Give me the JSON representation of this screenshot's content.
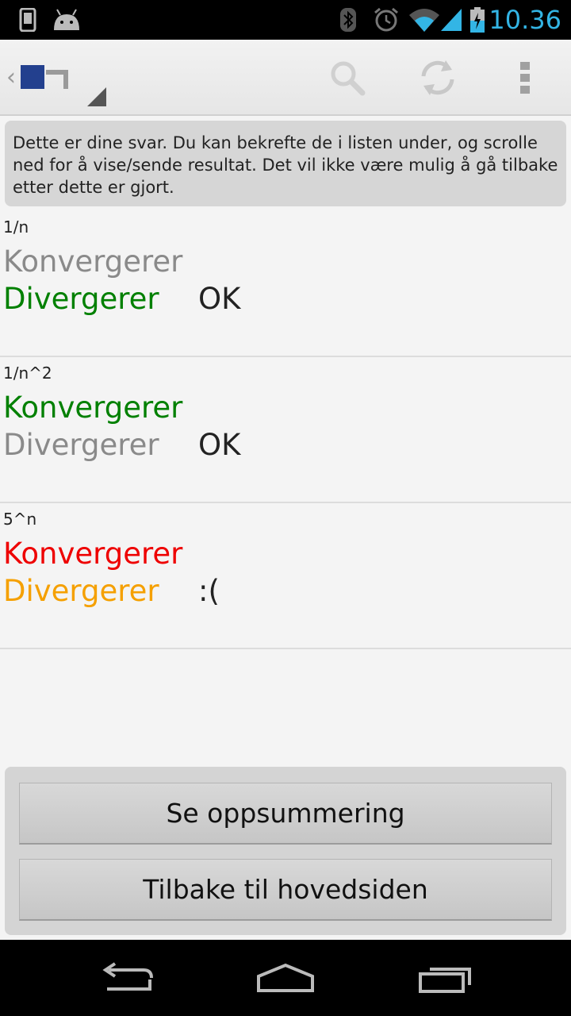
{
  "status_bar": {
    "time": "10.36",
    "icons": [
      "phone-icon",
      "android-icon",
      "bluetooth-icon",
      "alarm-icon",
      "wifi-icon",
      "signal-icon",
      "battery-charging-icon"
    ],
    "accent_color": "#33b5e5"
  },
  "action_bar": {
    "up_indicator": "‹",
    "logo_icon": "app-logo-icon",
    "actions": [
      "search-icon",
      "refresh-icon",
      "overflow-menu-icon"
    ]
  },
  "info": {
    "text": "Dette er dine svar. Du kan bekrefte de i listen under, og scrolle ned for å vise/sende resultat. Det vil ikke være mulig å gå tilbake etter dette er gjort."
  },
  "answers": [
    {
      "question": "1/n",
      "option1": {
        "label": "Konvergerer",
        "color": "#8a8a8a"
      },
      "option2": {
        "label": "Divergerer",
        "color": "#008000"
      },
      "verdict": "OK"
    },
    {
      "question": "1/n^2",
      "option1": {
        "label": "Konvergerer",
        "color": "#008000"
      },
      "option2": {
        "label": "Divergerer",
        "color": "#8a8a8a"
      },
      "verdict": "OK"
    },
    {
      "question": "5^n",
      "option1": {
        "label": "Konvergerer",
        "color": "#ee0000"
      },
      "option2": {
        "label": "Divergerer",
        "color": "#f5a000"
      },
      "verdict": ":("
    }
  ],
  "buttons": {
    "summary": "Se oppsummering",
    "back_home": "Tilbake til hovedsiden"
  },
  "nav_bar": {
    "icons": [
      "back-icon",
      "home-icon",
      "recent-apps-icon"
    ]
  }
}
